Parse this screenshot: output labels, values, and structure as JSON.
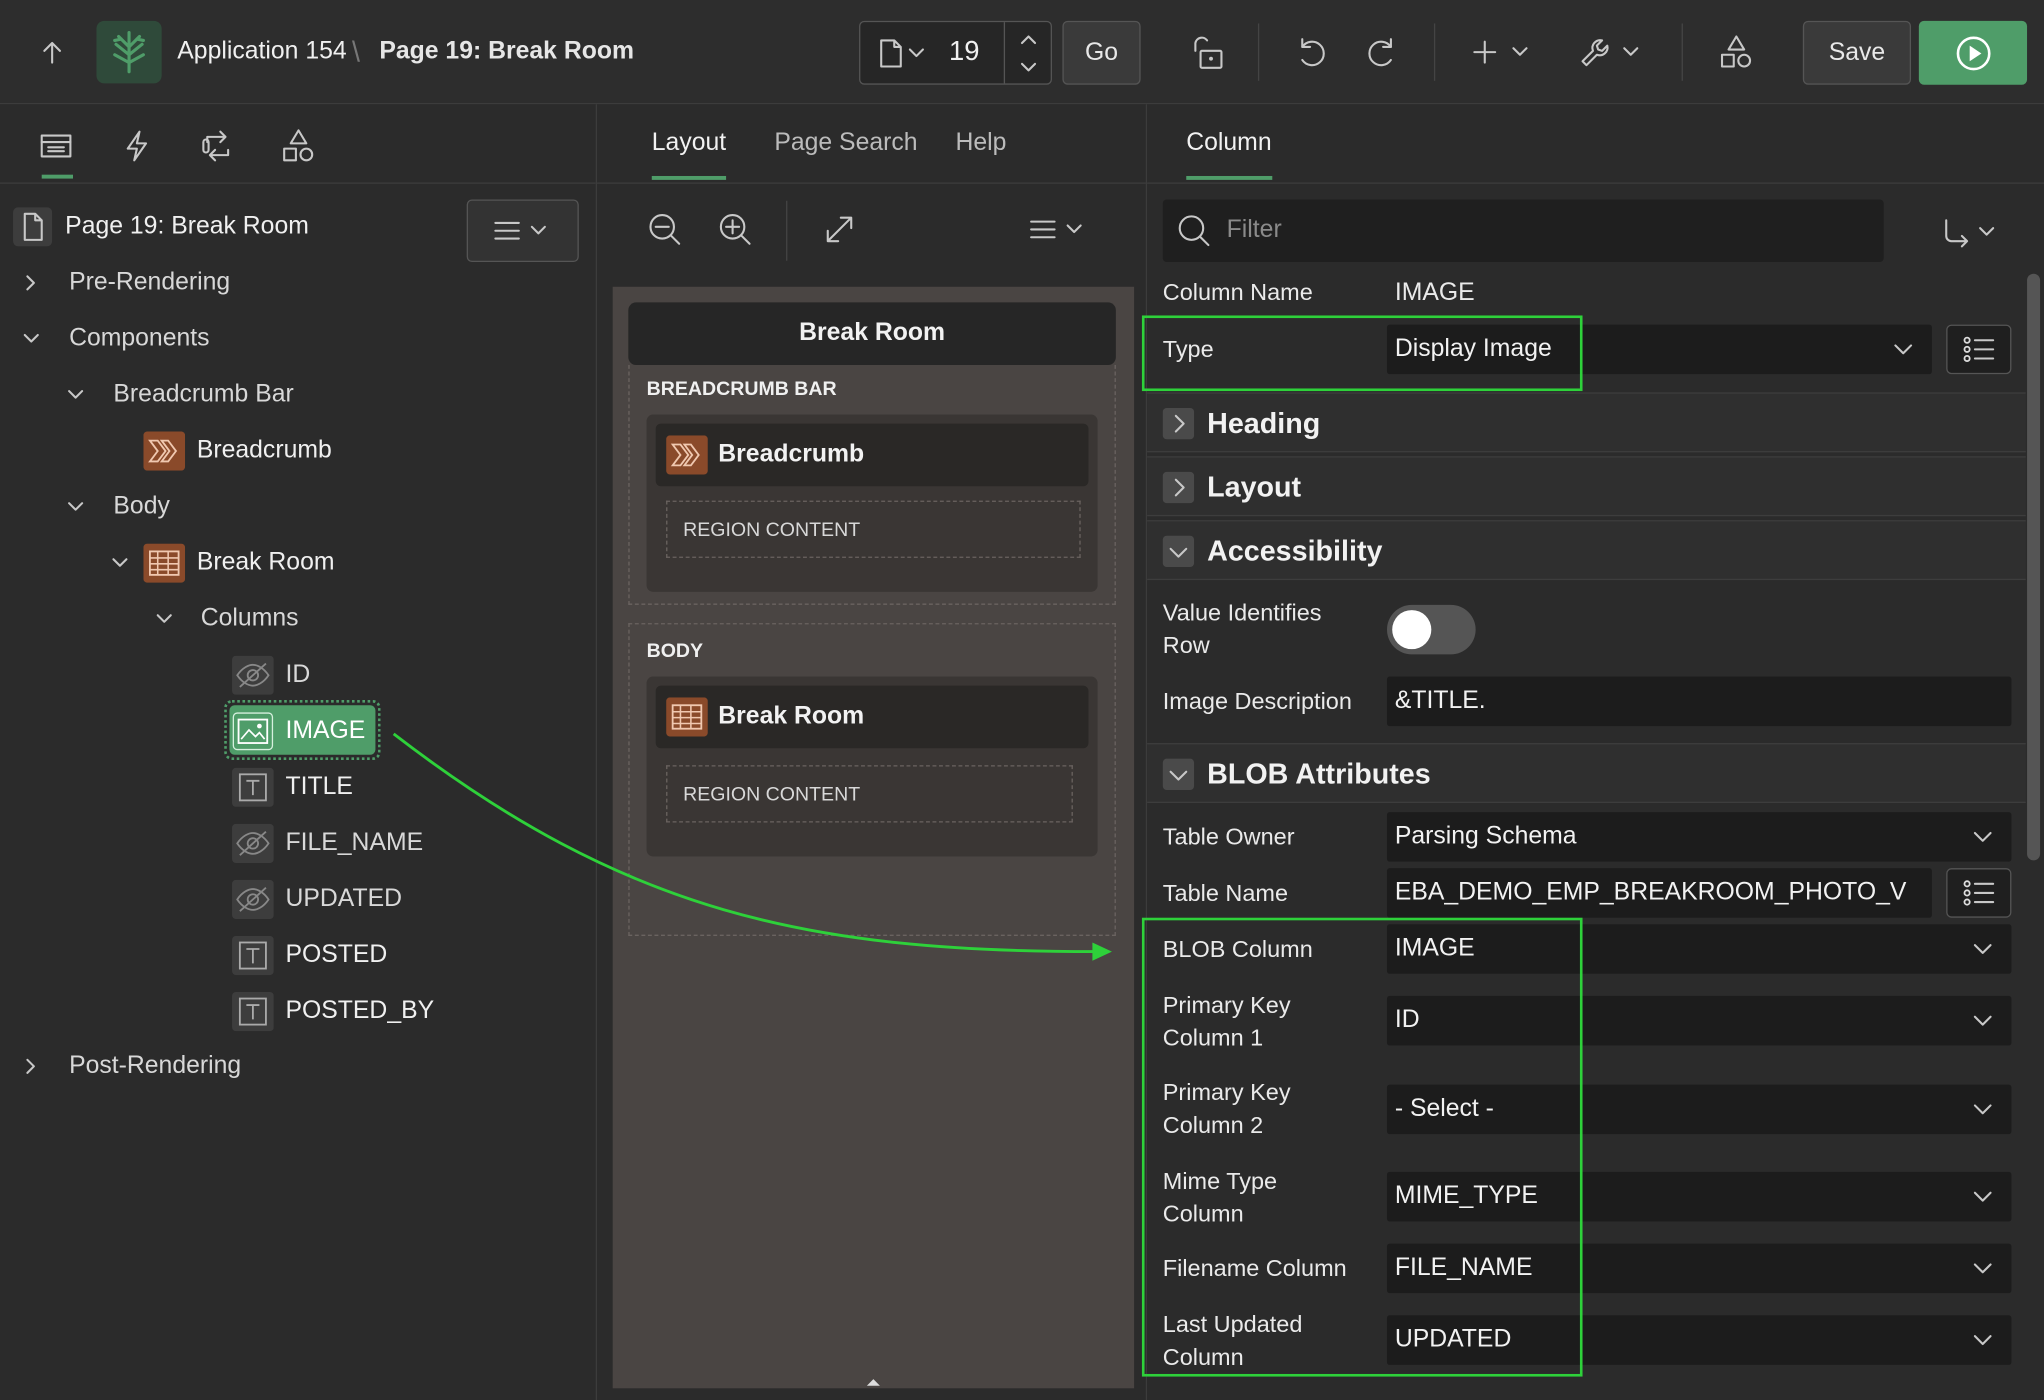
{
  "topbar": {
    "app_name": "Application 154",
    "separator": "\\",
    "page_title": "Page 19: Break Room",
    "page_number": "19",
    "go_label": "Go",
    "save_label": "Save"
  },
  "left": {
    "page_node": "Page 19: Break Room",
    "tree": {
      "pre_rendering": "Pre-Rendering",
      "components": "Components",
      "breadcrumb_bar": "Breadcrumb Bar",
      "breadcrumb": "Breadcrumb",
      "body": "Body",
      "break_room": "Break Room",
      "columns": "Columns",
      "col_id": "ID",
      "col_image": "IMAGE",
      "col_title": "TITLE",
      "col_file_name": "FILE_NAME",
      "col_updated": "UPDATED",
      "col_posted": "POSTED",
      "col_posted_by": "POSTED_BY",
      "post_rendering": "Post-Rendering"
    }
  },
  "middle": {
    "tabs": [
      "Layout",
      "Page Search",
      "Help"
    ],
    "page_header": "Break Room",
    "breadcrumb_bar_label": "BREADCRUMB BAR",
    "breadcrumb_region": "Breadcrumb",
    "region_content_1": "REGION CONTENT",
    "body_label": "BODY",
    "break_room_region": "Break Room",
    "region_content_2": "REGION CONTENT"
  },
  "right": {
    "tab": "Column",
    "filter_placeholder": "Filter",
    "column_name_label": "Column Name",
    "column_name_value": "IMAGE",
    "type_label": "Type",
    "type_value": "Display Image",
    "sections": {
      "heading": "Heading",
      "layout": "Layout",
      "accessibility": "Accessibility",
      "blob": "BLOB Attributes"
    },
    "value_identifies_row_label": [
      "Value Identifies",
      "Row"
    ],
    "value_identifies_row_on": false,
    "image_description_label": "Image Description",
    "image_description_value": "&TITLE.",
    "table_owner_label": "Table Owner",
    "table_owner_value": "Parsing Schema",
    "table_name_label": "Table Name",
    "table_name_value": "EBA_DEMO_EMP_BREAKROOM_PHOTO_V",
    "blob_column_label": "BLOB Column",
    "blob_column_value": "IMAGE",
    "pk1_label": [
      "Primary Key",
      "Column 1"
    ],
    "pk1_value": "ID",
    "pk2_label": [
      "Primary Key",
      "Column 2"
    ],
    "pk2_value": "- Select -",
    "mime_label": [
      "Mime Type",
      "Column"
    ],
    "mime_value": "MIME_TYPE",
    "filename_label": "Filename Column",
    "filename_value": "FILE_NAME",
    "last_updated_label": [
      "Last Updated",
      "Column"
    ],
    "last_updated_value": "UPDATED"
  },
  "colors": {
    "accent_green": "#4f9d69",
    "highlight_green": "#2ed13a",
    "region_icon_orange": "#8a4a2a"
  }
}
